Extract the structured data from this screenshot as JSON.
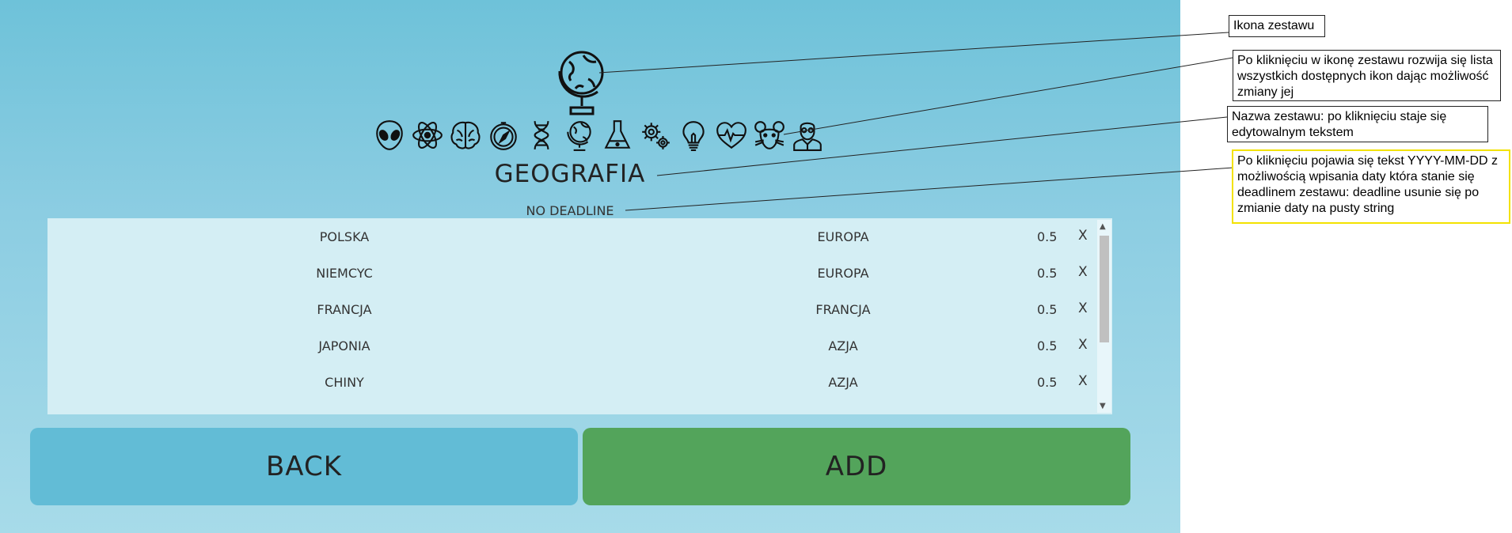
{
  "set": {
    "main_icon": "globe-icon",
    "icon_options": [
      "alien-icon",
      "atom-icon",
      "brain-icon",
      "compass-icon",
      "dna-icon",
      "globe-icon",
      "flask-icon",
      "gears-icon",
      "lightbulb-icon",
      "heartbeat-icon",
      "mouse-icon",
      "scientist-icon"
    ],
    "title": "GEOGRAFIA",
    "deadline": "NO DEADLINE"
  },
  "entries": [
    {
      "question": "POLSKA",
      "answer": "EUROPA",
      "weight": "0.5",
      "remove": "X"
    },
    {
      "question": "NIEMCYC",
      "answer": "EUROPA",
      "weight": "0.5",
      "remove": "X"
    },
    {
      "question": "FRANCJA",
      "answer": "FRANCJA",
      "weight": "0.5",
      "remove": "X"
    },
    {
      "question": "JAPONIA",
      "answer": "AZJA",
      "weight": "0.5",
      "remove": "X"
    },
    {
      "question": "CHINY",
      "answer": "AZJA",
      "weight": "0.5",
      "remove": "X"
    }
  ],
  "buttons": {
    "back": "BACK",
    "add": "ADD"
  },
  "annotations": {
    "set_icon": "Ikona zestawu",
    "icon_list": "Po kliknięciu w ikonę zestawu rozwija się lista wszystkich dostępnych ikon dając możliwość zmiany jej",
    "set_name": "Nazwa zestawu: po kliknięciu staje się edytowalnym tekstem",
    "deadline": "Po kliknięciu pojawia się tekst YYYY-MM-DD z możliwością wpisania daty która stanie się deadlinem zestawu: deadline usunie się po zmianie daty na pusty string"
  },
  "colors": {
    "background_top": "#6ec2d9",
    "background_bottom": "#a7dbe9",
    "list_bg": "#d4eef4",
    "back_button": "#62bcd6",
    "add_button": "#53a45b",
    "highlight_border": "#f3e200"
  }
}
